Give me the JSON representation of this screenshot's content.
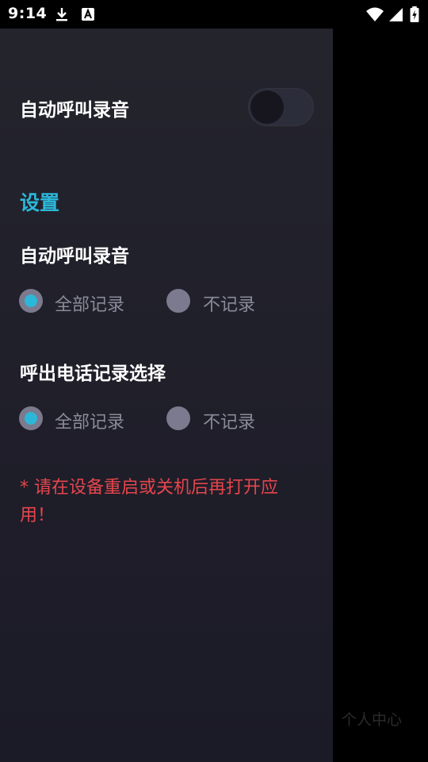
{
  "status_bar": {
    "time": "9:14",
    "icons": [
      "download-icon",
      "a-notification-icon",
      "wifi-icon",
      "cellular-signal-icon",
      "battery-charging-icon"
    ]
  },
  "drawer": {
    "toggle_row": {
      "label": "自动呼叫录音",
      "toggle_on": false
    },
    "settings": {
      "header": "设置",
      "auto_record": {
        "title": "自动呼叫录音",
        "options": [
          {
            "label": "全部记录",
            "selected": true
          },
          {
            "label": "不记录",
            "selected": false
          }
        ]
      },
      "outgoing_record": {
        "title": "呼出电话记录选择",
        "options": [
          {
            "label": "全部记录",
            "selected": true
          },
          {
            "label": "不记录",
            "selected": false
          }
        ]
      }
    },
    "warning": "* 请在设备重启或关机后再打开应用！"
  },
  "background": {
    "label": "个人中心"
  },
  "colors": {
    "accent": "#2cb7d9",
    "warning": "#e6454c",
    "drawer_bg": "#22222b",
    "radio_unselected": "#7c7a8e"
  }
}
